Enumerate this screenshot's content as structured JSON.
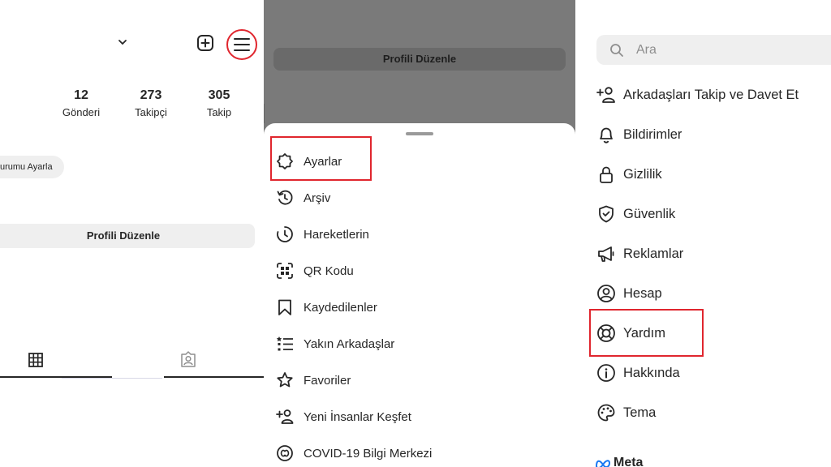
{
  "profile": {
    "stats": [
      {
        "value": "12",
        "label": "Gönderi"
      },
      {
        "value": "273",
        "label": "Takipçi"
      },
      {
        "value": "305",
        "label": "Takip"
      }
    ],
    "status_chip": "urumu Ayarla",
    "edit_profile": "Profili Düzenle"
  },
  "menu_sheet": {
    "background_edit_profile": "Profili Düzenle",
    "items": [
      {
        "label": "Ayarlar",
        "icon": "settings-icon"
      },
      {
        "label": "Arşiv",
        "icon": "archive-icon"
      },
      {
        "label": "Hareketlerin",
        "icon": "activity-icon"
      },
      {
        "label": "QR Kodu",
        "icon": "qr-code-icon"
      },
      {
        "label": "Kaydedilenler",
        "icon": "bookmark-icon"
      },
      {
        "label": "Yakın Arkadaşlar",
        "icon": "close-friends-icon"
      },
      {
        "label": "Favoriler",
        "icon": "star-icon"
      },
      {
        "label": "Yeni İnsanlar Keşfet",
        "icon": "add-person-icon"
      },
      {
        "label": "COVID-19 Bilgi Merkezi",
        "icon": "covid-info-icon"
      }
    ]
  },
  "settings": {
    "search_placeholder": "Ara",
    "items": [
      {
        "label": "Arkadaşları Takip ve Davet Et",
        "icon": "add-person-icon"
      },
      {
        "label": "Bildirimler",
        "icon": "bell-icon"
      },
      {
        "label": "Gizlilik",
        "icon": "lock-icon"
      },
      {
        "label": "Güvenlik",
        "icon": "shield-icon"
      },
      {
        "label": "Reklamlar",
        "icon": "megaphone-icon"
      },
      {
        "label": "Hesap",
        "icon": "account-icon"
      },
      {
        "label": "Yardım",
        "icon": "lifebuoy-icon"
      },
      {
        "label": "Hakkında",
        "icon": "info-icon"
      },
      {
        "label": "Tema",
        "icon": "palette-icon"
      }
    ],
    "footer_brand": "Meta"
  },
  "colors": {
    "highlight": "#e0262e",
    "text": "#262626",
    "dim_overlay": "#7a7a7a",
    "button_bg": "#efefef"
  }
}
